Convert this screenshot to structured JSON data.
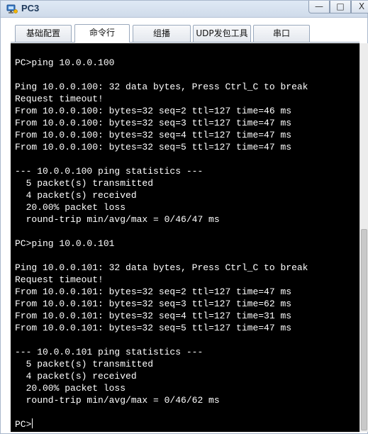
{
  "window": {
    "title": "PC3",
    "controls": {
      "minimize": "—",
      "maximize": "□",
      "close": "X"
    }
  },
  "tabs": [
    {
      "label": "基础配置",
      "active": false
    },
    {
      "label": "命令行",
      "active": true
    },
    {
      "label": "组播",
      "active": false
    },
    {
      "label": "UDP发包工具",
      "active": false
    },
    {
      "label": "串口",
      "active": false
    }
  ],
  "terminal": {
    "lines": [
      "PC>ping 10.0.0.100",
      "",
      "Ping 10.0.0.100: 32 data bytes, Press Ctrl_C to break",
      "Request timeout!",
      "From 10.0.0.100: bytes=32 seq=2 ttl=127 time=46 ms",
      "From 10.0.0.100: bytes=32 seq=3 ttl=127 time=47 ms",
      "From 10.0.0.100: bytes=32 seq=4 ttl=127 time=47 ms",
      "From 10.0.0.100: bytes=32 seq=5 ttl=127 time=47 ms",
      "",
      "--- 10.0.0.100 ping statistics ---",
      "  5 packet(s) transmitted",
      "  4 packet(s) received",
      "  20.00% packet loss",
      "  round-trip min/avg/max = 0/46/47 ms",
      "",
      "PC>ping 10.0.0.101",
      "",
      "Ping 10.0.0.101: 32 data bytes, Press Ctrl_C to break",
      "Request timeout!",
      "From 10.0.0.101: bytes=32 seq=2 ttl=127 time=47 ms",
      "From 10.0.0.101: bytes=32 seq=3 ttl=127 time=62 ms",
      "From 10.0.0.101: bytes=32 seq=4 ttl=127 time=31 ms",
      "From 10.0.0.101: bytes=32 seq=5 ttl=127 time=47 ms",
      "",
      "--- 10.0.0.101 ping statistics ---",
      "  5 packet(s) transmitted",
      "  4 packet(s) received",
      "  20.00% packet loss",
      "  round-trip min/avg/max = 0/46/62 ms",
      ""
    ],
    "prompt": "PC>"
  },
  "colors": {
    "terminal_bg": "#000000",
    "terminal_fg": "#ffffff",
    "titlebar": "#dfe9f5",
    "title_text": "#1e395b"
  },
  "icons": {
    "app": "pc-icon"
  }
}
